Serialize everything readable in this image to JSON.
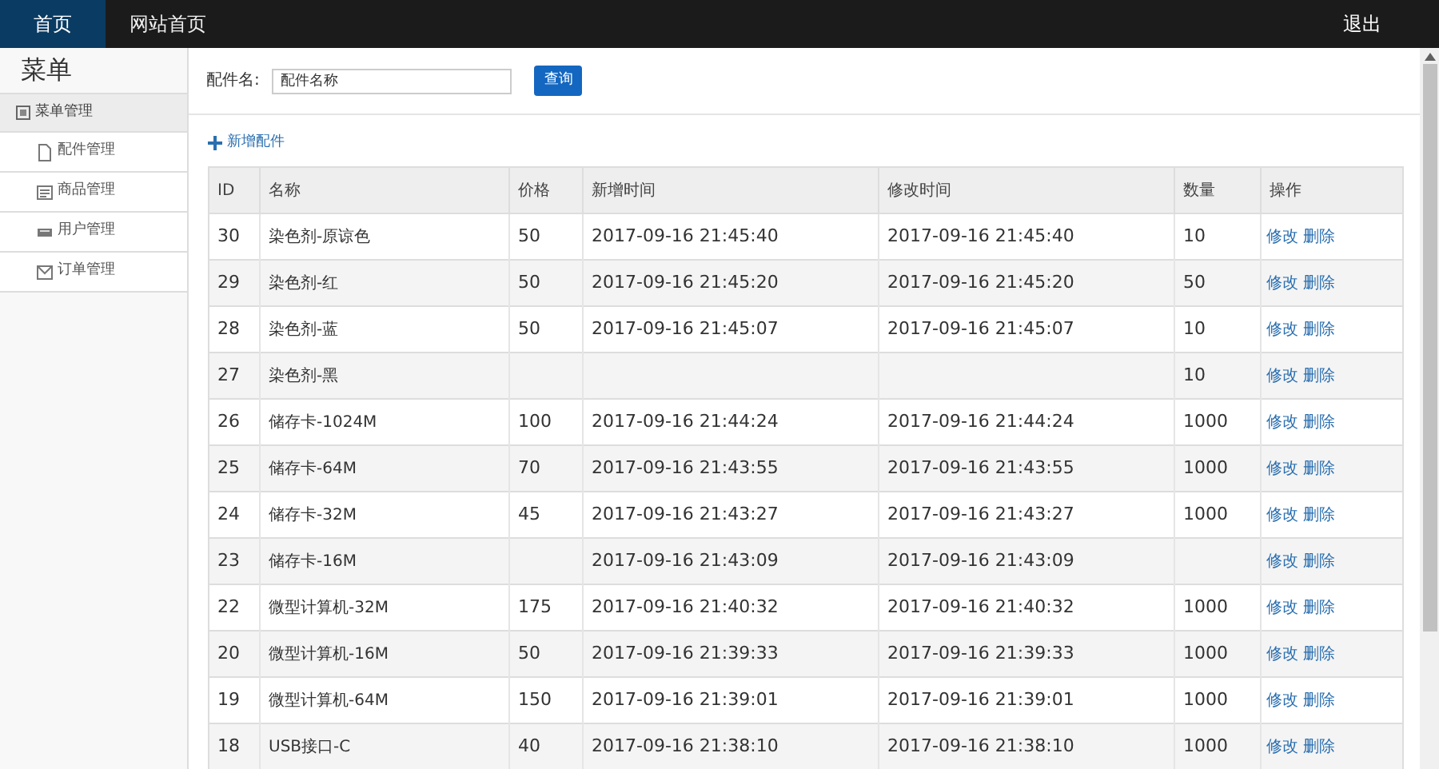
{
  "nav": {
    "tabs": [
      {
        "label": "首页",
        "selected": true
      },
      {
        "label": "网站首页",
        "selected": false
      }
    ],
    "logout": "退出"
  },
  "sidebar": {
    "title": "菜单",
    "group": "菜单管理",
    "items": [
      {
        "label": "配件管理"
      },
      {
        "label": "商品管理"
      },
      {
        "label": "用户管理"
      },
      {
        "label": "订单管理"
      }
    ]
  },
  "search": {
    "label": "配件名:",
    "value": "配件名称",
    "button": "查询"
  },
  "add_link": "新增配件",
  "table": {
    "columns": [
      "ID",
      "名称",
      "价格",
      "新增时间",
      "修改时间",
      "数量",
      "操作"
    ],
    "rows": [
      {
        "id": "30",
        "name": "染色剂-原谅色",
        "price": "50",
        "created": "2017-09-16 21:45:40",
        "modified": "2017-09-16 21:45:40",
        "qty": "10",
        "actions": [
          "修改",
          "删除"
        ]
      },
      {
        "id": "29",
        "name": "染色剂-红",
        "price": "50",
        "created": "2017-09-16 21:45:20",
        "modified": "2017-09-16 21:45:20",
        "qty": "50",
        "actions": [
          "修改",
          "删除"
        ]
      },
      {
        "id": "28",
        "name": "染色剂-蓝",
        "price": "50",
        "created": "2017-09-16 21:45:07",
        "modified": "2017-09-16 21:45:07",
        "qty": "10",
        "actions": [
          "修改",
          "删除"
        ]
      },
      {
        "id": "27",
        "name": "染色剂-黑",
        "qty": "10",
        "actions": [
          "修改",
          "删除"
        ]
      },
      {
        "id": "26",
        "name": "储存卡-1024M",
        "price": "100",
        "created": "2017-09-16 21:44:24",
        "modified": "2017-09-16 21:44:24",
        "qty": "1000",
        "actions": [
          "修改",
          "删除"
        ]
      },
      {
        "id": "25",
        "name": "储存卡-64M",
        "price": "70",
        "created": "2017-09-16 21:43:55",
        "modified": "2017-09-16 21:43:55",
        "qty": "1000",
        "actions": [
          "修改",
          "删除"
        ]
      },
      {
        "id": "24",
        "name": "储存卡-32M",
        "price": "45",
        "created": "2017-09-16 21:43:27",
        "modified": "2017-09-16 21:43:27",
        "qty": "1000",
        "actions": [
          "修改",
          "删除"
        ]
      },
      {
        "id": "23",
        "name": "储存卡-16M",
        "created": "2017-09-16 21:43:09",
        "modified": "2017-09-16 21:43:09",
        "actions": [
          "修改",
          "删除"
        ]
      },
      {
        "id": "22",
        "name": "微型计算机-32M",
        "price": "175",
        "created": "2017-09-16 21:40:32",
        "modified": "2017-09-16 21:40:32",
        "qty": "1000",
        "actions": [
          "修改",
          "删除"
        ]
      },
      {
        "id": "20",
        "name": "微型计算机-16M",
        "price": "50",
        "created": "2017-09-16 21:39:33",
        "modified": "2017-09-16 21:39:33",
        "qty": "1000",
        "actions": [
          "修改",
          "删除"
        ]
      },
      {
        "id": "19",
        "name": "微型计算机-64M",
        "price": "150",
        "created": "2017-09-16 21:39:01",
        "modified": "2017-09-16 21:39:01",
        "qty": "1000",
        "actions": [
          "修改",
          "删除"
        ]
      },
      {
        "id": "18",
        "name": "USB接口-C",
        "price": "40",
        "created": "2017-09-16 21:38:10",
        "modified": "2017-09-16 21:38:10",
        "qty": "1000",
        "actions": [
          "修改",
          "删除"
        ]
      }
    ]
  }
}
